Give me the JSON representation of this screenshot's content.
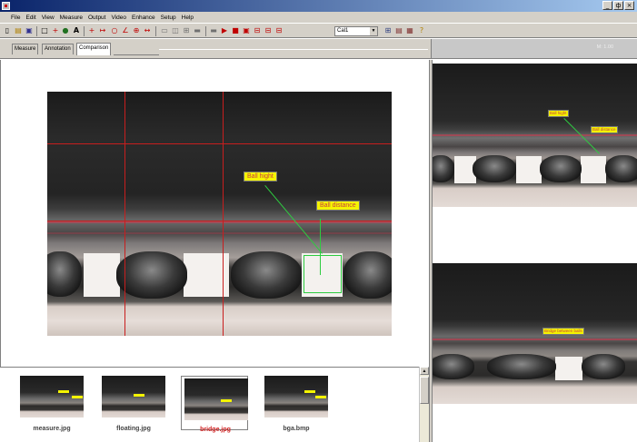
{
  "window": {
    "controls": [
      "_",
      "ф",
      "×"
    ]
  },
  "menu": [
    "File",
    "Edit",
    "View",
    "Measure",
    "Output",
    "Video",
    "Enhance",
    "Setup",
    "Help"
  ],
  "toolbar": {
    "calibration_value": "Cal1"
  },
  "tabs": [
    "Measure",
    "Annotation",
    "Comparison"
  ],
  "active_tab": "Comparison",
  "right_header": {
    "text": "M: 1.00"
  },
  "main_view": {
    "annotations": [
      {
        "label": "Ball hight"
      },
      {
        "label": "Ball distance"
      }
    ]
  },
  "side_views": [
    {
      "annotations": [
        {
          "label": "Ball hight"
        },
        {
          "label": "Ball distance"
        }
      ]
    },
    {
      "annotations": [
        {
          "label": "Bridge between balls"
        }
      ]
    }
  ],
  "thumbnails": [
    {
      "label": "measure.jpg",
      "selected": false
    },
    {
      "label": "floating.jpg",
      "selected": false
    },
    {
      "label": "bridge.jpg",
      "selected": true
    },
    {
      "label": "bga.bmp",
      "selected": false
    }
  ],
  "colors": {
    "measure_line": "#c81e1e",
    "annotation_line": "#2ecc40",
    "label_bg": "#f4f401",
    "selected_label": "#d02020"
  }
}
